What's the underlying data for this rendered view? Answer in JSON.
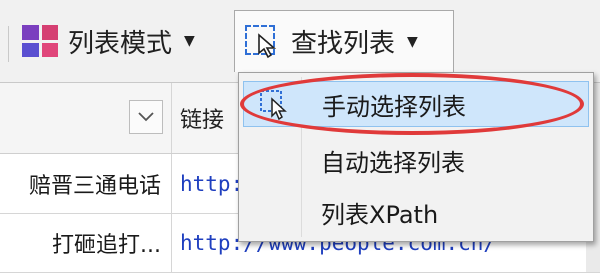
{
  "toolbar": {
    "list_mode_label": "列表模式",
    "find_list_label": "查找列表",
    "dropdown_arrow": "▼"
  },
  "table": {
    "header": {
      "col2_label": "链接"
    },
    "rows": [
      {
        "text": "赔晋三通电话",
        "link": "http://www.people.com.cn/"
      },
      {
        "text": "打砸追打...",
        "link": "http://www.people.com.cn/"
      }
    ]
  },
  "menu": {
    "items": [
      {
        "label": "手动选择列表",
        "highlighted": true
      },
      {
        "label": "自动选择列表",
        "highlighted": false
      },
      {
        "label": "列表XPath",
        "highlighted": false
      }
    ]
  },
  "colors": {
    "annotation_ring": "#e03a3a",
    "menu_highlight": "#cfe6fb",
    "link_text": "#1f3fbf"
  },
  "icons": [
    "list-mode-icon",
    "find-list-icon",
    "dropdown-arrow-icon",
    "manual-select-icon"
  ]
}
